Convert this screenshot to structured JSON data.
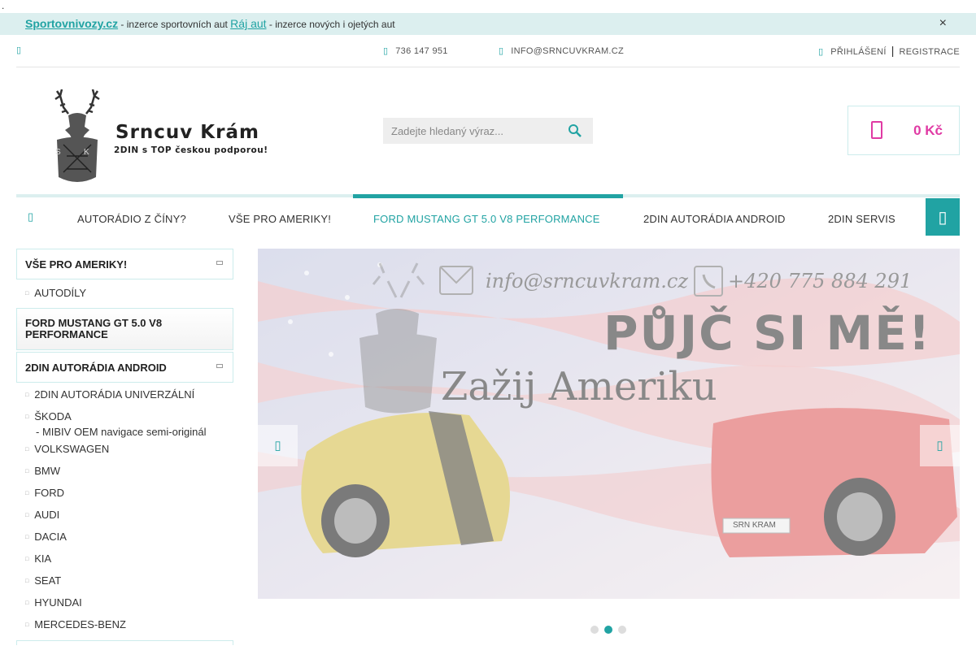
{
  "promo": {
    "link1": "Sportovnivozy.cz",
    "text1": " - inzerce sportovních aut ",
    "link2": "Ráj aut",
    "text2": " - inzerce nových i ojetých aut",
    "close": "×"
  },
  "topbar": {
    "phone": "736 147 951",
    "email": "INFO@SRNCUVKRAM.CZ",
    "login": "PŘIHLÁŠENÍ",
    "separator": "|",
    "register": "REGISTRACE"
  },
  "logo": {
    "name": "Srncuv Krám",
    "tagline": "2DIN s TOP českou podporou!",
    "monogram_left": "S",
    "monogram_right": "K"
  },
  "search": {
    "placeholder": "Zadejte hledaný výraz...",
    "value": ""
  },
  "cart": {
    "total": "0 Kč"
  },
  "nav": {
    "items": [
      "AUTORÁDIO Z ČÍNY?",
      "VŠE PRO AMERIKY!",
      "FORD MUSTANG GT 5.0 V8 PERFORMANCE",
      "2DIN AUTORÁDIA ANDROID",
      "2DIN SERVIS"
    ],
    "active_index": 2
  },
  "sidebar": {
    "cat1": {
      "label": "VŠE PRO AMERIKY!",
      "children": [
        "AUTODÍLY"
      ]
    },
    "cat2": {
      "label": "FORD MUSTANG GT 5.0 V8 PERFORMANCE"
    },
    "cat3": {
      "label": "2DIN AUTORÁDIA ANDROID",
      "children": [
        "2DIN AUTORÁDIA UNIVERZÁLNÍ",
        "ŠKODA",
        "VOLKSWAGEN",
        "BMW",
        "FORD",
        "AUDI",
        "DACIA",
        "KIA",
        "SEAT",
        "HYUNDAI",
        "MERCEDES-BENZ"
      ],
      "skoda_note": "- MIBIV OEM navigace semi-originál"
    }
  },
  "banner": {
    "email": "info@srncuvkram.cz",
    "phone": "+420 775 884 291",
    "headline": "PŮJČ SI MĚ!",
    "subline": "Zažij Ameriku",
    "plate": "SRN KRAM",
    "active_slide": 2,
    "slide_count": 3
  },
  "colors": {
    "accent": "#21a3a3",
    "cart": "#e03aa4",
    "promo_bg": "#dcefef"
  }
}
